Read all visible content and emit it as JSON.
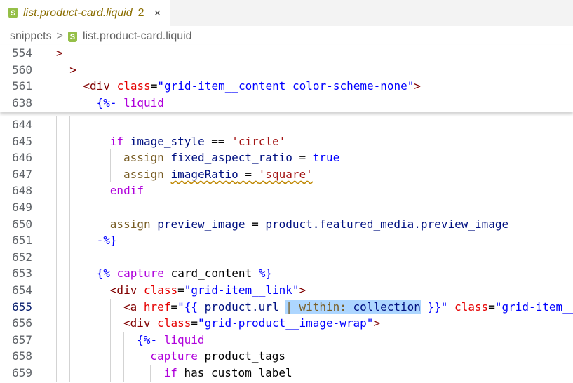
{
  "tab": {
    "title": "list.product-card.liquid",
    "problems": "2",
    "close_icon": "×",
    "icon": "S"
  },
  "breadcrumb": {
    "folder": "snippets",
    "separator": ">",
    "file": "list.product-card.liquid"
  },
  "active_line": "655",
  "sticky_lines": [
    {
      "num": "554",
      "indent": 0,
      "tokens": [
        [
          ">",
          "tag"
        ]
      ]
    },
    {
      "num": "560",
      "indent": 1,
      "tokens": [
        [
          ">",
          "tag"
        ]
      ]
    },
    {
      "num": "561",
      "indent": 2,
      "tokens": [
        [
          "<div ",
          "tag"
        ],
        [
          "class",
          "attr"
        ],
        [
          "=",
          "plain"
        ],
        [
          "\"grid-item__content color-scheme-none\"",
          "str"
        ],
        [
          ">",
          "tag"
        ]
      ]
    },
    {
      "num": "638",
      "indent": 3,
      "tokens": [
        [
          "{%-",
          "delim"
        ],
        [
          " liquid",
          "kw"
        ]
      ]
    }
  ],
  "lines": [
    {
      "num": "644",
      "indent": 4,
      "tokens": []
    },
    {
      "num": "645",
      "indent": 4,
      "tokens": [
        [
          "if",
          "kw"
        ],
        [
          " image_style ",
          "var"
        ],
        [
          "==",
          "plain"
        ],
        [
          " ",
          "plain"
        ],
        [
          "'circle'",
          "sq"
        ]
      ]
    },
    {
      "num": "646",
      "indent": 5,
      "tokens": [
        [
          "assign",
          "fn"
        ],
        [
          " fixed_aspect_ratio ",
          "var"
        ],
        [
          "= ",
          "plain"
        ],
        [
          "true",
          "const"
        ]
      ]
    },
    {
      "num": "647",
      "indent": 5,
      "tokens": [
        [
          "assign",
          "fn"
        ],
        [
          " ",
          "plain"
        ],
        [
          "imageRatio",
          "var warn"
        ],
        [
          " = ",
          "plain warn"
        ],
        [
          "'square'",
          "sq warn"
        ]
      ]
    },
    {
      "num": "648",
      "indent": 4,
      "tokens": [
        [
          "endif",
          "kw"
        ]
      ]
    },
    {
      "num": "649",
      "indent": 4,
      "tokens": []
    },
    {
      "num": "650",
      "indent": 4,
      "tokens": [
        [
          "assign",
          "fn"
        ],
        [
          " preview_image ",
          "var"
        ],
        [
          "= ",
          "plain"
        ],
        [
          "product.featured_media.preview_image",
          "var"
        ]
      ]
    },
    {
      "num": "651",
      "indent": 3,
      "tokens": [
        [
          "-%}",
          "delim"
        ]
      ]
    },
    {
      "num": "652",
      "indent": 3,
      "tokens": []
    },
    {
      "num": "653",
      "indent": 3,
      "tokens": [
        [
          "{%",
          "delim"
        ],
        [
          " capture",
          "kw"
        ],
        [
          " card_content ",
          "plain"
        ],
        [
          "%}",
          "delim"
        ]
      ]
    },
    {
      "num": "654",
      "indent": 4,
      "tokens": [
        [
          "<div ",
          "tag"
        ],
        [
          "class",
          "attr"
        ],
        [
          "=",
          "plain"
        ],
        [
          "\"grid-item__link\"",
          "str"
        ],
        [
          ">",
          "tag"
        ]
      ]
    },
    {
      "num": "655",
      "indent": 5,
      "tokens": [
        [
          "<a ",
          "tag"
        ],
        [
          "href",
          "attr"
        ],
        [
          "=",
          "plain"
        ],
        [
          "\"",
          "str"
        ],
        [
          "{{",
          "delim"
        ],
        [
          " product.url ",
          "var"
        ],
        [
          "| within: ",
          "fn hl"
        ],
        [
          "collection",
          "var hl"
        ],
        [
          " }}",
          "delim"
        ],
        [
          "\"",
          "str"
        ],
        [
          " class",
          "attr"
        ],
        [
          "=",
          "plain"
        ],
        [
          "\"grid-item__",
          "str"
        ]
      ]
    },
    {
      "num": "656",
      "indent": 5,
      "tokens": [
        [
          "<div ",
          "tag"
        ],
        [
          "class",
          "attr"
        ],
        [
          "=",
          "plain"
        ],
        [
          "\"grid-product__image-wrap\"",
          "str"
        ],
        [
          ">",
          "tag"
        ]
      ]
    },
    {
      "num": "657",
      "indent": 6,
      "tokens": [
        [
          "{%-",
          "delim"
        ],
        [
          " liquid",
          "kw"
        ]
      ]
    },
    {
      "num": "658",
      "indent": 7,
      "tokens": [
        [
          "capture",
          "kw"
        ],
        [
          " product_tags",
          "plain"
        ]
      ]
    },
    {
      "num": "659",
      "indent": 8,
      "tokens": [
        [
          "if",
          "kw"
        ],
        [
          " has_custom_label",
          "plain"
        ]
      ]
    }
  ]
}
